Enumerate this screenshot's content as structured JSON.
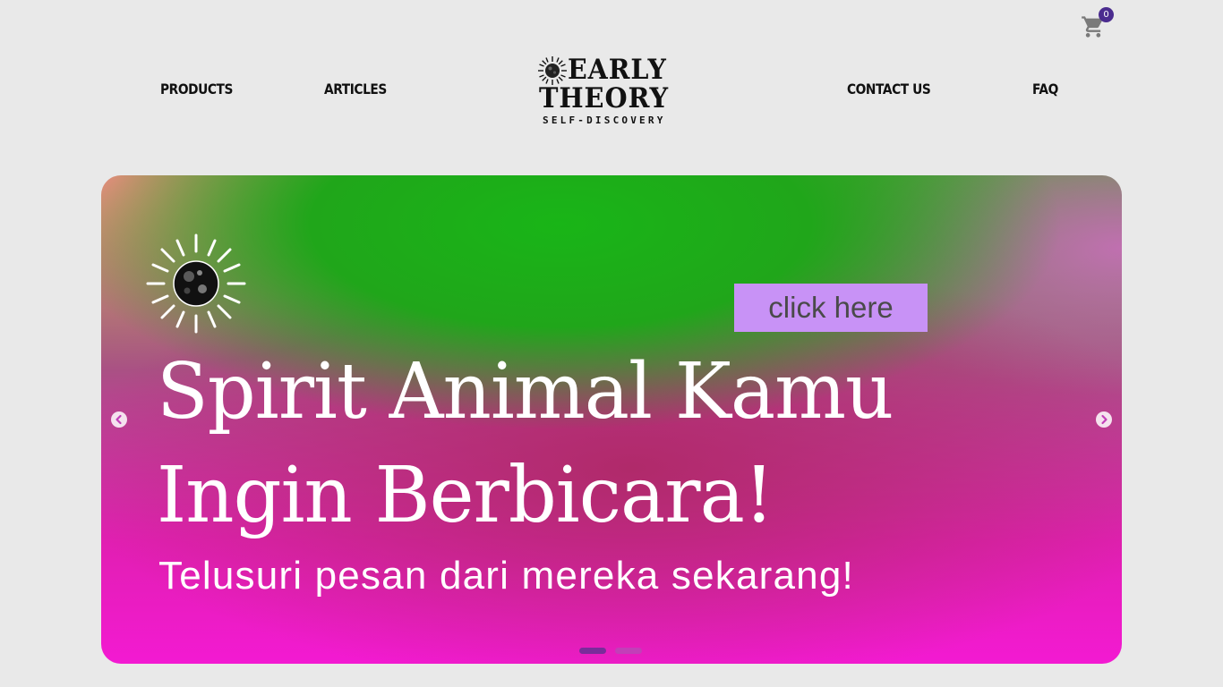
{
  "header": {
    "cart": {
      "icon": "cart-icon",
      "count": "0",
      "badge_color": "#4b2c8f"
    },
    "nav_left": [
      {
        "label": "PRODUCTS"
      },
      {
        "label": "ARTICLES"
      }
    ],
    "nav_right": [
      {
        "label": "CONTACT US"
      },
      {
        "label": "FAQ"
      }
    ],
    "logo": {
      "line1": "EARLY",
      "line2": "THEORY",
      "tagline": "SELF-DISCOVERY",
      "icon": "sun-moon-icon"
    }
  },
  "banner": {
    "cta_label": "click here",
    "cta_color": "#c892f6",
    "headline_line1": "Spirit Animal Kamu",
    "headline_line2": "Ingin Berbicara!",
    "subheadline": "Telusuri pesan dari mereka sekarang!",
    "icon": "sun-moon-icon",
    "prev_icon": "chevron-left-icon",
    "next_icon": "chevron-right-icon",
    "slide_count": 2,
    "active_slide": 1,
    "colors": {
      "top": "#19b517",
      "bottom": "#f31ad2",
      "text": "#ffffff"
    }
  }
}
